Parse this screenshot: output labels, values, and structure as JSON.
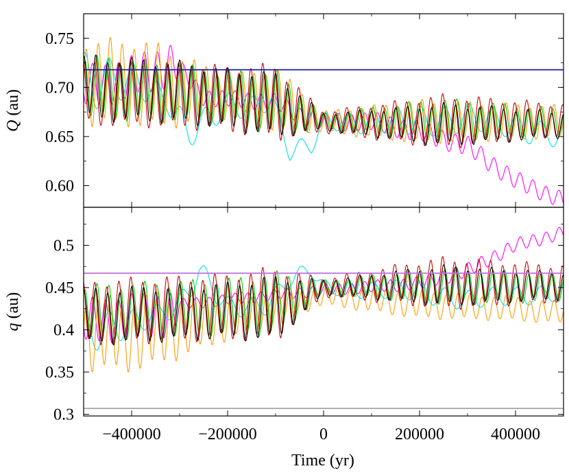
{
  "chart_data": {
    "type": "line",
    "xlabel": "Time (yr)",
    "xlim": [
      -500000,
      500000
    ],
    "xticks": [
      {
        "value": -400000,
        "label": "−400000"
      },
      {
        "value": -200000,
        "label": "−200000"
      },
      {
        "value": 0,
        "label": "0"
      },
      {
        "value": 200000,
        "label": "200000"
      },
      {
        "value": 400000,
        "label": "400000"
      }
    ],
    "panels": [
      {
        "id": "Q",
        "ylabel": "Q (au)",
        "ylabel_var": "Q",
        "ylabel_unit": "(au)",
        "ylim": [
          0.578,
          0.775
        ],
        "yticks": [
          "0.60",
          "0.65",
          "0.70",
          "0.75"
        ],
        "yticks_values": [
          0.6,
          0.65,
          0.7,
          0.75
        ],
        "reference_lines": [
          {
            "value": 0.718,
            "color": "#1a1aa0"
          }
        ],
        "series": [
          {
            "color": "#ff00ff",
            "keypoints": [
              [
                -500000,
                0.7
              ],
              [
                -400000,
                0.71
              ],
              [
                -310000,
                0.725
              ],
              [
                -250000,
                0.69
              ],
              [
                -200000,
                0.688
              ],
              [
                -100000,
                0.685
              ],
              [
                -50000,
                0.672
              ],
              [
                0,
                0.665
              ],
              [
                100000,
                0.665
              ],
              [
                200000,
                0.655
              ],
              [
                300000,
                0.64
              ],
              [
                400000,
                0.605
              ],
              [
                500000,
                0.585
              ]
            ],
            "amplitudes": [
              [
                -500000,
                0.02
              ],
              [
                -310000,
                0.02
              ],
              [
                -300000,
                0.008
              ],
              [
                0,
                0.008
              ],
              [
                200000,
                0.01
              ],
              [
                500000,
                0.008
              ]
            ],
            "period": 27000,
            "phase": 0.5
          },
          {
            "color": "#00e0e0",
            "keypoints": [
              [
                -500000,
                0.71
              ],
              [
                -400000,
                0.705
              ],
              [
                -330000,
                0.69
              ],
              [
                -280000,
                0.655
              ],
              [
                -200000,
                0.68
              ],
              [
                -150000,
                0.68
              ],
              [
                -110000,
                0.69
              ],
              [
                -70000,
                0.635
              ],
              [
                -25000,
                0.64
              ],
              [
                0,
                0.665
              ],
              [
                200000,
                0.665
              ],
              [
                300000,
                0.67
              ],
              [
                500000,
                0.65
              ]
            ],
            "amplitudes": [
              [
                -500000,
                0.03
              ],
              [
                -330000,
                0.01
              ],
              [
                -300000,
                0.015
              ],
              [
                0,
                0.008
              ],
              [
                200000,
                0.015
              ],
              [
                500000,
                0.012
              ]
            ],
            "period": 50000,
            "phase": 1.2
          },
          {
            "color": "#ff9900",
            "keypoints": [
              [
                -500000,
                0.705
              ],
              [
                -400000,
                0.705
              ],
              [
                -200000,
                0.69
              ],
              [
                -100000,
                0.688
              ],
              [
                0,
                0.665
              ],
              [
                200000,
                0.665
              ],
              [
                400000,
                0.665
              ],
              [
                500000,
                0.665
              ]
            ],
            "amplitudes": [
              [
                -500000,
                0.04
              ],
              [
                -350000,
                0.04
              ],
              [
                -200000,
                0.02
              ],
              [
                -100000,
                0.03
              ],
              [
                0,
                0.01
              ],
              [
                200000,
                0.02
              ],
              [
                500000,
                0.015
              ]
            ],
            "period": 25000,
            "phase": 0.2
          },
          {
            "color": "#00cc00",
            "keypoints": [
              [
                -500000,
                0.7
              ],
              [
                -300000,
                0.695
              ],
              [
                -100000,
                0.685
              ],
              [
                0,
                0.665
              ],
              [
                200000,
                0.667
              ],
              [
                500000,
                0.665
              ]
            ],
            "amplitudes": [
              [
                -500000,
                0.03
              ],
              [
                -200000,
                0.025
              ],
              [
                -100000,
                0.03
              ],
              [
                0,
                0.008
              ],
              [
                250000,
                0.02
              ],
              [
                500000,
                0.012
              ]
            ],
            "period": 25000,
            "phase": 0.9
          },
          {
            "color": "#cc0000",
            "keypoints": [
              [
                -500000,
                0.695
              ],
              [
                -300000,
                0.692
              ],
              [
                -100000,
                0.685
              ],
              [
                0,
                0.665
              ],
              [
                200000,
                0.665
              ],
              [
                500000,
                0.667
              ]
            ],
            "amplitudes": [
              [
                -500000,
                0.03
              ],
              [
                -200000,
                0.03
              ],
              [
                -100000,
                0.035
              ],
              [
                0,
                0.01
              ],
              [
                250000,
                0.025
              ],
              [
                500000,
                0.015
              ]
            ],
            "period": 25000,
            "phase": 2.0
          },
          {
            "color": "#000000",
            "keypoints": [
              [
                -500000,
                0.7
              ],
              [
                -300000,
                0.695
              ],
              [
                -100000,
                0.682
              ],
              [
                0,
                0.665
              ],
              [
                200000,
                0.662
              ],
              [
                500000,
                0.662
              ]
            ],
            "amplitudes": [
              [
                -500000,
                0.03
              ],
              [
                -200000,
                0.028
              ],
              [
                -100000,
                0.03
              ],
              [
                0,
                0.008
              ],
              [
                250000,
                0.02
              ],
              [
                500000,
                0.012
              ]
            ],
            "period": 25000,
            "phase": 1.5
          }
        ]
      },
      {
        "id": "q",
        "ylabel": "q (au)",
        "ylabel_var": "q",
        "ylabel_unit": "(au)",
        "ylim": [
          0.298,
          0.545
        ],
        "yticks": [
          "0.3",
          "0.35",
          "0.4",
          "0.45",
          "0.5"
        ],
        "yticks_values": [
          0.3,
          0.35,
          0.4,
          0.45,
          0.5
        ],
        "reference_lines": [
          {
            "value": 0.467,
            "color": "#c070e0"
          },
          {
            "value": 0.307,
            "color": "#aaaaaa"
          }
        ],
        "series": [
          {
            "color": "#ff00ff",
            "keypoints": [
              [
                -500000,
                0.41
              ],
              [
                -310000,
                0.42
              ],
              [
                -300000,
                0.43
              ],
              [
                0,
                0.447
              ],
              [
                200000,
                0.455
              ],
              [
                300000,
                0.47
              ],
              [
                400000,
                0.5
              ],
              [
                500000,
                0.515
              ]
            ],
            "amplitudes": [
              [
                -500000,
                0.025
              ],
              [
                -310000,
                0.025
              ],
              [
                -300000,
                0.006
              ],
              [
                0,
                0.006
              ],
              [
                300000,
                0.008
              ],
              [
                500000,
                0.007
              ]
            ],
            "period": 27000,
            "phase": 0.5
          },
          {
            "color": "#00e0e0",
            "keypoints": [
              [
                -500000,
                0.4
              ],
              [
                -400000,
                0.405
              ],
              [
                -300000,
                0.43
              ],
              [
                -260000,
                0.47
              ],
              [
                -200000,
                0.425
              ],
              [
                -120000,
                0.43
              ],
              [
                -70000,
                0.46
              ],
              [
                -25000,
                0.47
              ],
              [
                0,
                0.45
              ],
              [
                200000,
                0.445
              ],
              [
                300000,
                0.435
              ],
              [
                500000,
                0.445
              ]
            ],
            "amplitudes": [
              [
                -500000,
                0.025
              ],
              [
                -330000,
                0.01
              ],
              [
                -300000,
                0.015
              ],
              [
                0,
                0.008
              ],
              [
                200000,
                0.012
              ],
              [
                500000,
                0.01
              ]
            ],
            "period": 50000,
            "phase": 1.2
          },
          {
            "color": "#ff9900",
            "keypoints": [
              [
                -500000,
                0.395
              ],
              [
                -400000,
                0.395
              ],
              [
                -200000,
                0.415
              ],
              [
                0,
                0.44
              ],
              [
                200000,
                0.43
              ],
              [
                400000,
                0.425
              ],
              [
                500000,
                0.42
              ]
            ],
            "amplitudes": [
              [
                -500000,
                0.04
              ],
              [
                -350000,
                0.04
              ],
              [
                -200000,
                0.025
              ],
              [
                0,
                0.01
              ],
              [
                200000,
                0.015
              ],
              [
                500000,
                0.012
              ]
            ],
            "period": 25000,
            "phase": 0.2
          },
          {
            "color": "#00cc00",
            "keypoints": [
              [
                -500000,
                0.42
              ],
              [
                -300000,
                0.425
              ],
              [
                -100000,
                0.43
              ],
              [
                0,
                0.45
              ],
              [
                200000,
                0.452
              ],
              [
                500000,
                0.45
              ]
            ],
            "amplitudes": [
              [
                -500000,
                0.03
              ],
              [
                -200000,
                0.03
              ],
              [
                -100000,
                0.035
              ],
              [
                0,
                0.008
              ],
              [
                250000,
                0.02
              ],
              [
                500000,
                0.015
              ]
            ],
            "period": 25000,
            "phase": 0.9
          },
          {
            "color": "#cc0000",
            "keypoints": [
              [
                -500000,
                0.42
              ],
              [
                -300000,
                0.425
              ],
              [
                -100000,
                0.43
              ],
              [
                0,
                0.45
              ],
              [
                200000,
                0.455
              ],
              [
                500000,
                0.455
              ]
            ],
            "amplitudes": [
              [
                -500000,
                0.035
              ],
              [
                -200000,
                0.035
              ],
              [
                -100000,
                0.04
              ],
              [
                0,
                0.01
              ],
              [
                250000,
                0.028
              ],
              [
                500000,
                0.02
              ]
            ],
            "period": 25000,
            "phase": 2.0
          },
          {
            "color": "#000000",
            "keypoints": [
              [
                -500000,
                0.415
              ],
              [
                -300000,
                0.42
              ],
              [
                -100000,
                0.425
              ],
              [
                0,
                0.45
              ],
              [
                200000,
                0.452
              ],
              [
                500000,
                0.452
              ]
            ],
            "amplitudes": [
              [
                -500000,
                0.03
              ],
              [
                -200000,
                0.03
              ],
              [
                -100000,
                0.035
              ],
              [
                0,
                0.008
              ],
              [
                250000,
                0.022
              ],
              [
                500000,
                0.015
              ]
            ],
            "period": 25000,
            "phase": 1.5
          }
        ]
      }
    ]
  }
}
